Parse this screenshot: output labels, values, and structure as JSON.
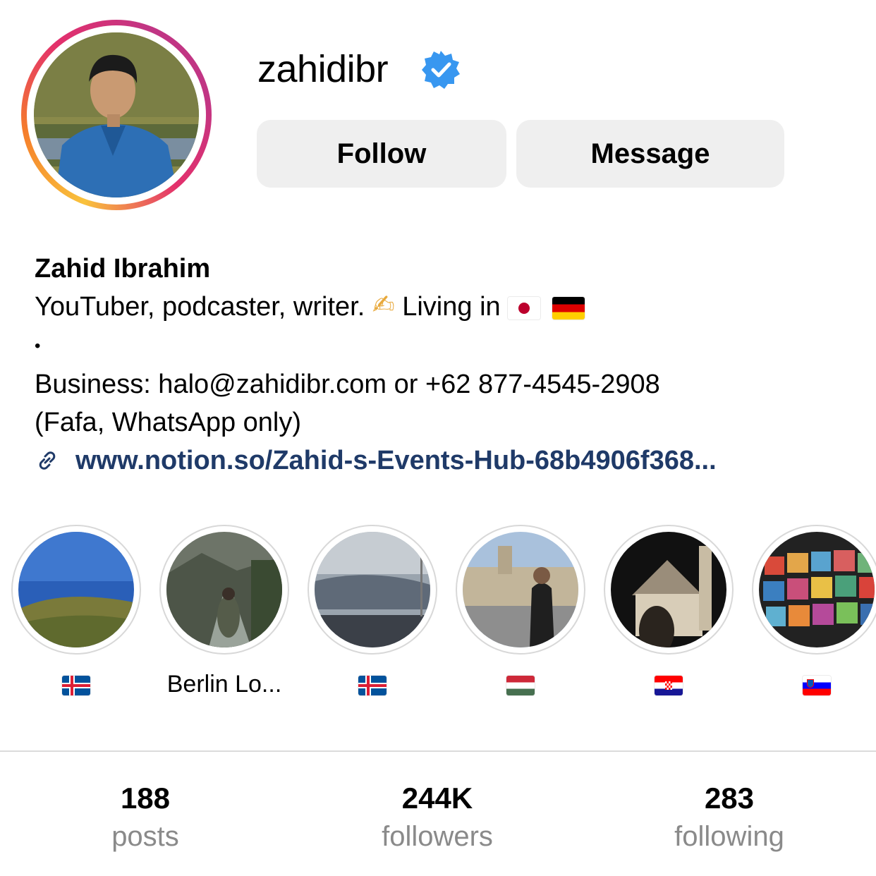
{
  "profile": {
    "username": "zahidibr",
    "verified": true,
    "display_name": "Zahid Ibrahim",
    "bio_line1": "YouTuber, podcaster, writer.",
    "bio_line1_emoji": "✍",
    "bio_living": "Living in",
    "bio_flags": [
      "japan-flag",
      "germany-flag"
    ],
    "bio_separator": "•",
    "bio_business": "Business: halo@zahidibr.com or +62 877-4545-2908",
    "bio_business_note": "(Fafa, WhatsApp only)",
    "link": "www.notion.so/Zahid-s-Events-Hub-68b4906f368..."
  },
  "actions": {
    "follow_label": "Follow",
    "message_label": "Message"
  },
  "highlights": [
    {
      "label": "",
      "flag": "iceland-flag"
    },
    {
      "label": "Berlin Lo...",
      "flag": ""
    },
    {
      "label": "",
      "flag": "iceland-flag"
    },
    {
      "label": "",
      "flag": "hungary-flag"
    },
    {
      "label": "",
      "flag": "croatia-flag"
    },
    {
      "label": "",
      "flag": "slovenia-flag"
    }
  ],
  "stats": {
    "posts_count": "188",
    "posts_label": "posts",
    "followers_count": "244K",
    "followers_label": "followers",
    "following_count": "283",
    "following_label": "following"
  },
  "colors": {
    "verified": "#3897f0",
    "link": "#1f3a68",
    "button_bg": "#efefef",
    "muted": "#8a8a8a"
  }
}
